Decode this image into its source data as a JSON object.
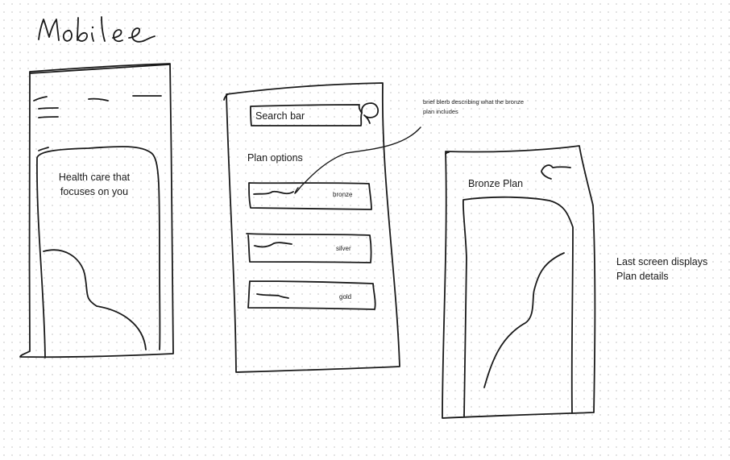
{
  "board": {
    "title": "Mobile"
  },
  "screen_home": {
    "hero_text": "Health care that focuses you",
    "hero_line_1": "Health care that",
    "hero_line_2": "focuses on you"
  },
  "screen_plans": {
    "search_placeholder": "Search bar",
    "section_heading": "Plan options",
    "plans": [
      {
        "label": "bronze"
      },
      {
        "label": "silver"
      },
      {
        "label": "gold"
      }
    ]
  },
  "annotation_bronze": {
    "line_1": "brief blerb describing what the bronze",
    "line_2": "plan includes"
  },
  "screen_detail": {
    "title": "Bronze Plan"
  },
  "side_note": {
    "line_1": "Last screen displays",
    "line_2": "Plan details"
  }
}
